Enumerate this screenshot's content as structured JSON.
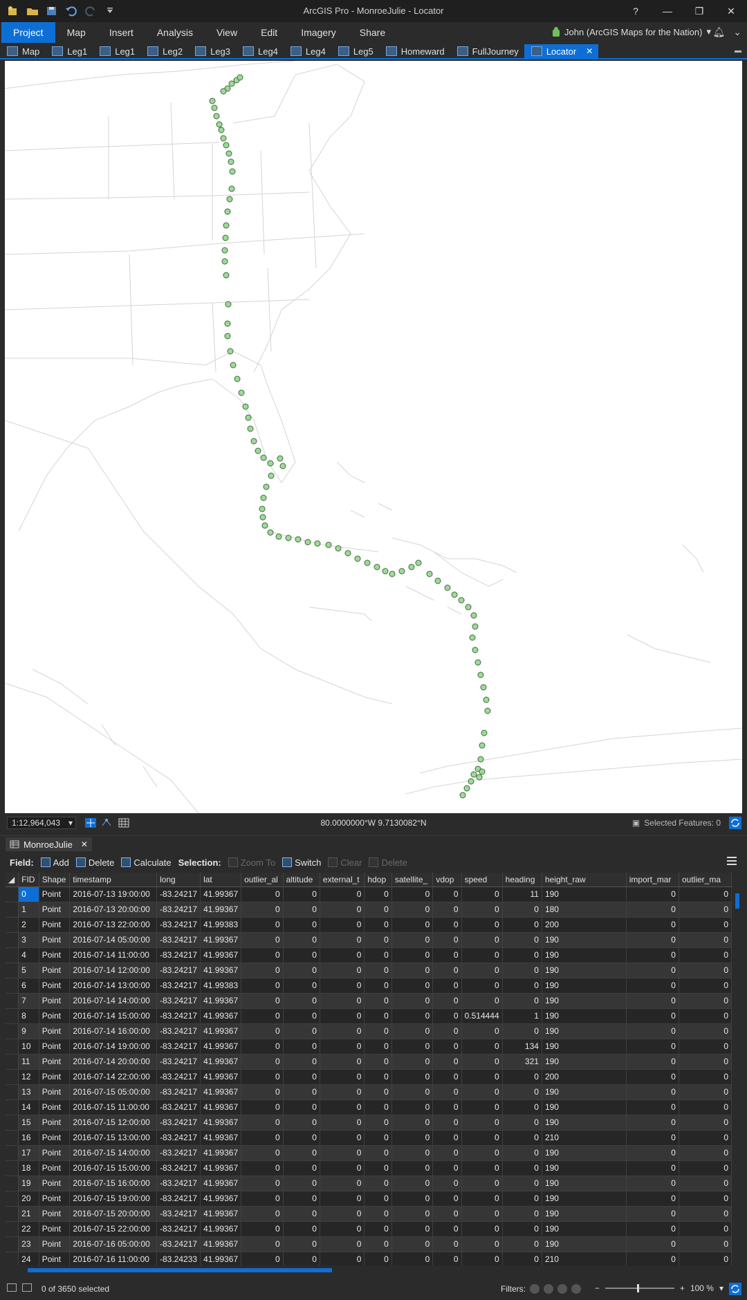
{
  "window": {
    "title": "ArcGIS Pro - MonroeJulie - Locator",
    "help": "?",
    "minimize": "—",
    "restore": "❐",
    "close": "✕"
  },
  "ribbon": {
    "tabs": [
      "Project",
      "Map",
      "Insert",
      "Analysis",
      "View",
      "Edit",
      "Imagery",
      "Share"
    ],
    "user": "John (ArcGIS Maps for the Nation)"
  },
  "view_tabs": [
    "Map",
    "Leg1",
    "Leg1",
    "Leg2",
    "Leg3",
    "Leg4",
    "Leg4",
    "Leg5",
    "Homeward",
    "FullJourney",
    "Locator"
  ],
  "map_status": {
    "scale": "1:12,964,043",
    "coordinates": "80.0000000°W 9.7130082°N",
    "selected_features": "Selected Features: 0"
  },
  "table": {
    "tab_name": "MonroeJulie",
    "toolbar": {
      "field_label": "Field:",
      "add": "Add",
      "delete": "Delete",
      "calculate": "Calculate",
      "selection_label": "Selection:",
      "zoom_to": "Zoom To",
      "switch": "Switch",
      "clear": "Clear",
      "delete_sel": "Delete"
    },
    "columns": [
      "FID",
      "Shape",
      "timestamp",
      "long",
      "lat",
      "outlier_al",
      "altitude",
      "external_t",
      "hdop",
      "satellite_",
      "vdop",
      "speed",
      "heading",
      "height_raw",
      "import_mar",
      "outlier_ma"
    ],
    "rows": [
      [
        "0",
        "Point",
        "2016-07-13 19:00:00",
        "-83.24217",
        "41.99367",
        "0",
        "0",
        "0",
        "0",
        "0",
        "0",
        "0",
        "11",
        "190",
        "0",
        "0"
      ],
      [
        "1",
        "Point",
        "2016-07-13 20:00:00",
        "-83.24217",
        "41.99367",
        "0",
        "0",
        "0",
        "0",
        "0",
        "0",
        "0",
        "0",
        "180",
        "0",
        "0"
      ],
      [
        "2",
        "Point",
        "2016-07-13 22:00:00",
        "-83.24217",
        "41.99383",
        "0",
        "0",
        "0",
        "0",
        "0",
        "0",
        "0",
        "0",
        "200",
        "0",
        "0"
      ],
      [
        "3",
        "Point",
        "2016-07-14 05:00:00",
        "-83.24217",
        "41.99367",
        "0",
        "0",
        "0",
        "0",
        "0",
        "0",
        "0",
        "0",
        "190",
        "0",
        "0"
      ],
      [
        "4",
        "Point",
        "2016-07-14 11:00:00",
        "-83.24217",
        "41.99367",
        "0",
        "0",
        "0",
        "0",
        "0",
        "0",
        "0",
        "0",
        "190",
        "0",
        "0"
      ],
      [
        "5",
        "Point",
        "2016-07-14 12:00:00",
        "-83.24217",
        "41.99367",
        "0",
        "0",
        "0",
        "0",
        "0",
        "0",
        "0",
        "0",
        "190",
        "0",
        "0"
      ],
      [
        "6",
        "Point",
        "2016-07-14 13:00:00",
        "-83.24217",
        "41.99383",
        "0",
        "0",
        "0",
        "0",
        "0",
        "0",
        "0",
        "0",
        "190",
        "0",
        "0"
      ],
      [
        "7",
        "Point",
        "2016-07-14 14:00:00",
        "-83.24217",
        "41.99367",
        "0",
        "0",
        "0",
        "0",
        "0",
        "0",
        "0",
        "0",
        "190",
        "0",
        "0"
      ],
      [
        "8",
        "Point",
        "2016-07-14 15:00:00",
        "-83.24217",
        "41.99367",
        "0",
        "0",
        "0",
        "0",
        "0",
        "0",
        "0.514444",
        "1",
        "190",
        "0",
        "0"
      ],
      [
        "9",
        "Point",
        "2016-07-14 16:00:00",
        "-83.24217",
        "41.99367",
        "0",
        "0",
        "0",
        "0",
        "0",
        "0",
        "0",
        "0",
        "190",
        "0",
        "0"
      ],
      [
        "10",
        "Point",
        "2016-07-14 19:00:00",
        "-83.24217",
        "41.99367",
        "0",
        "0",
        "0",
        "0",
        "0",
        "0",
        "0",
        "134",
        "190",
        "0",
        "0"
      ],
      [
        "11",
        "Point",
        "2016-07-14 20:00:00",
        "-83.24217",
        "41.99367",
        "0",
        "0",
        "0",
        "0",
        "0",
        "0",
        "0",
        "321",
        "190",
        "0",
        "0"
      ],
      [
        "12",
        "Point",
        "2016-07-14 22:00:00",
        "-83.24217",
        "41.99367",
        "0",
        "0",
        "0",
        "0",
        "0",
        "0",
        "0",
        "0",
        "200",
        "0",
        "0"
      ],
      [
        "13",
        "Point",
        "2016-07-15 05:00:00",
        "-83.24217",
        "41.99367",
        "0",
        "0",
        "0",
        "0",
        "0",
        "0",
        "0",
        "0",
        "190",
        "0",
        "0"
      ],
      [
        "14",
        "Point",
        "2016-07-15 11:00:00",
        "-83.24217",
        "41.99367",
        "0",
        "0",
        "0",
        "0",
        "0",
        "0",
        "0",
        "0",
        "190",
        "0",
        "0"
      ],
      [
        "15",
        "Point",
        "2016-07-15 12:00:00",
        "-83.24217",
        "41.99367",
        "0",
        "0",
        "0",
        "0",
        "0",
        "0",
        "0",
        "0",
        "190",
        "0",
        "0"
      ],
      [
        "16",
        "Point",
        "2016-07-15 13:00:00",
        "-83.24217",
        "41.99367",
        "0",
        "0",
        "0",
        "0",
        "0",
        "0",
        "0",
        "0",
        "210",
        "0",
        "0"
      ],
      [
        "17",
        "Point",
        "2016-07-15 14:00:00",
        "-83.24217",
        "41.99367",
        "0",
        "0",
        "0",
        "0",
        "0",
        "0",
        "0",
        "0",
        "190",
        "0",
        "0"
      ],
      [
        "18",
        "Point",
        "2016-07-15 15:00:00",
        "-83.24217",
        "41.99367",
        "0",
        "0",
        "0",
        "0",
        "0",
        "0",
        "0",
        "0",
        "190",
        "0",
        "0"
      ],
      [
        "19",
        "Point",
        "2016-07-15 16:00:00",
        "-83.24217",
        "41.99367",
        "0",
        "0",
        "0",
        "0",
        "0",
        "0",
        "0",
        "0",
        "190",
        "0",
        "0"
      ],
      [
        "20",
        "Point",
        "2016-07-15 19:00:00",
        "-83.24217",
        "41.99367",
        "0",
        "0",
        "0",
        "0",
        "0",
        "0",
        "0",
        "0",
        "190",
        "0",
        "0"
      ],
      [
        "21",
        "Point",
        "2016-07-15 20:00:00",
        "-83.24217",
        "41.99367",
        "0",
        "0",
        "0",
        "0",
        "0",
        "0",
        "0",
        "0",
        "190",
        "0",
        "0"
      ],
      [
        "22",
        "Point",
        "2016-07-15 22:00:00",
        "-83.24217",
        "41.99367",
        "0",
        "0",
        "0",
        "0",
        "0",
        "0",
        "0",
        "0",
        "190",
        "0",
        "0"
      ],
      [
        "23",
        "Point",
        "2016-07-16 05:00:00",
        "-83.24217",
        "41.99367",
        "0",
        "0",
        "0",
        "0",
        "0",
        "0",
        "0",
        "0",
        "190",
        "0",
        "0"
      ],
      [
        "24",
        "Point",
        "2016-07-16 11:00:00",
        "-83.24233",
        "41.99367",
        "0",
        "0",
        "0",
        "0",
        "0",
        "0",
        "0",
        "0",
        "210",
        "0",
        "0"
      ]
    ]
  },
  "status": {
    "selected": "0 of 3650 selected",
    "filters": "Filters:",
    "zoom": "100 %"
  },
  "colors": {
    "accent": "#0d6fd6",
    "track_fill": "#9fd99a",
    "track_stroke": "#3f6a3a"
  }
}
